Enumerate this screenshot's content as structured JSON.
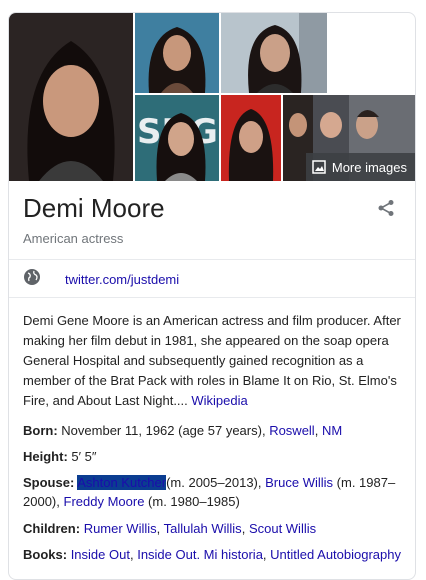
{
  "images": {
    "more_label": "More images",
    "portrait_text": "SNG"
  },
  "entity": {
    "name": "Demi Moore",
    "subtitle": "American actress"
  },
  "social": {
    "link": "twitter.com/justdemi"
  },
  "description": {
    "text": "Demi Gene Moore is an American actress and film producer. After making her film debut in 1981, she appeared on the soap opera General Hospital and subsequently gained recognition as a member of the Brat Pack with roles in Blame It on Rio, St. Elmo's Fire, and About Last Night.... ",
    "source": "Wikipedia"
  },
  "facts": {
    "born": {
      "label": "Born:",
      "text": "November 11, 1962 (age 57 years),",
      "place1": "Roswell",
      "sep": ",",
      "place2": "NM"
    },
    "height": {
      "label": "Height:",
      "value": "5′ 5″"
    },
    "spouse": {
      "label": "Spouse:",
      "s1": "Ashton Kutcher",
      "s1_years": "(m. 2005–2013),",
      "s2": "Bruce Willis",
      "s2_years": "(m. 1987–2000),",
      "s3": "Freddy Moore",
      "s3_years": "(m. 1980–1985)"
    },
    "children": {
      "label": "Children:",
      "c1": "Rumer Willis",
      "c2": "Tallulah Willis",
      "c3": "Scout Willis",
      "sep": ","
    },
    "books": {
      "label": "Books:",
      "b1": "Inside Out",
      "b2": "Inside Out. Mi historia",
      "b3": "Untitled Autobiography",
      "sep": ","
    }
  },
  "colors": {
    "link": "#1a0dab",
    "highlight": "#0b3d91"
  }
}
